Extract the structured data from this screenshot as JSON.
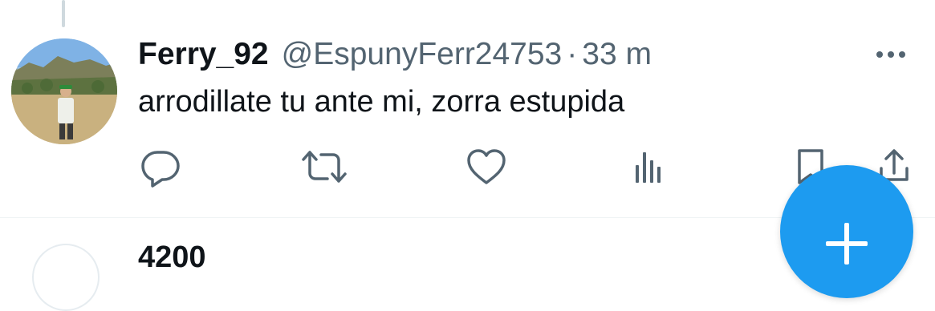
{
  "tweet": {
    "display_name": "Ferry_92",
    "handle": "@EspunyFerr24753",
    "separator": "·",
    "timestamp": "33 m",
    "text": "arrodillate tu ante mi, zorra estupida"
  },
  "actions": [
    {
      "name": "reply",
      "icon": "reply-icon"
    },
    {
      "name": "retweet",
      "icon": "retweet-icon"
    },
    {
      "name": "like",
      "icon": "heart-icon"
    },
    {
      "name": "views",
      "icon": "views-icon"
    },
    {
      "name": "bookmark",
      "icon": "bookmark-icon"
    },
    {
      "name": "share",
      "icon": "share-icon"
    }
  ],
  "next_tweet": {
    "display_name_fragment": "4200"
  },
  "colors": {
    "accent": "#1d9bf0",
    "text_primary": "#0f1419",
    "text_secondary": "#536471",
    "divider": "#eff3f4"
  }
}
